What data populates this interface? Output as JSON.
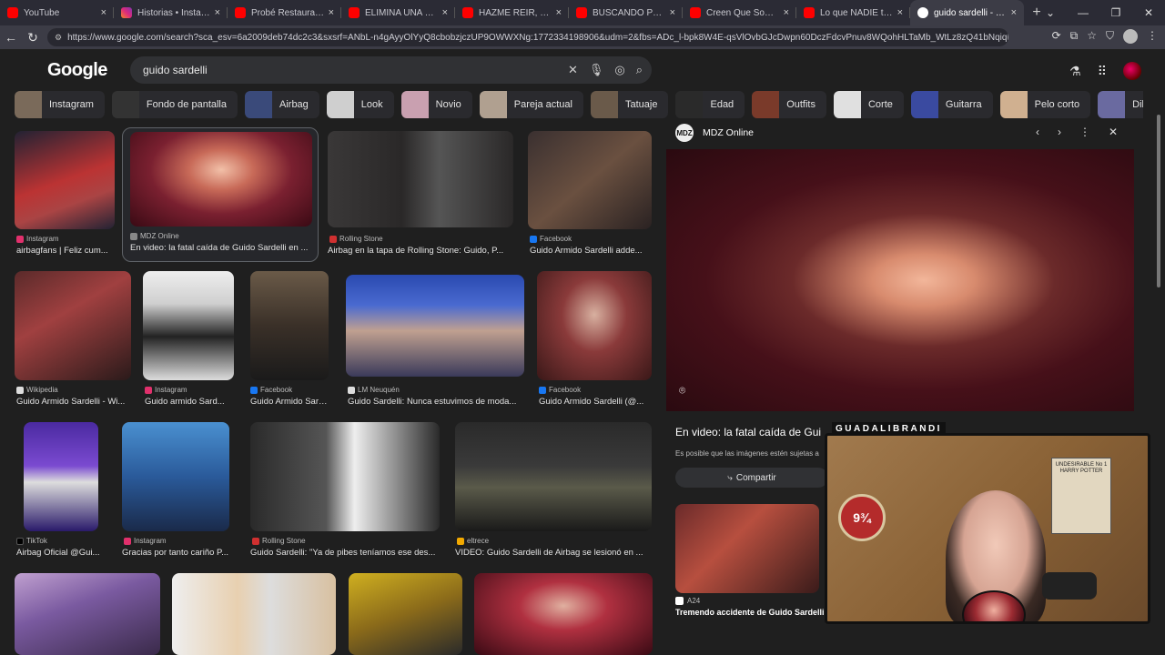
{
  "browser": {
    "tabs": [
      {
        "label": "YouTube",
        "color": "#ff0000"
      },
      {
        "label": "Historias • Instagram",
        "color": "#e1306c"
      },
      {
        "label": "Probé Restaurantes con",
        "color": "#ff0000"
      },
      {
        "label": "ELIMINA UNA CANCIÓN",
        "color": "#ff0000"
      },
      {
        "label": "HAZME REIR, GANA 100",
        "color": "#ff0000"
      },
      {
        "label": "BUSCANDO PROBLEMA",
        "color": "#ff0000"
      },
      {
        "label": "Creen Que Somos Tonto",
        "color": "#ff0000"
      },
      {
        "label": "Lo que NADIE te cuenta",
        "color": "#ff0000"
      },
      {
        "label": "guido sardelli - Buscar con",
        "color": "#4285f4"
      }
    ],
    "close_glyph": "×",
    "new_tab": "+",
    "url": "https://www.google.com/search?sca_esv=6a2009deb74dc2c3&sxsrf=ANbL-n4gAyyOlYyQ8cbobzjczUP9OWWXNg:1772334198906&udm=2&fbs=ADc_l-bpk8W4E-qsVlOvbGJcDwpn60DczFdcvPnuv8WQohHLTaMb_WtLz8zQ41bNqiqMK_2tAHCL8fGF2x..."
  },
  "google": {
    "logo": "Google",
    "query": "guido sardelli"
  },
  "chips": [
    {
      "label": "Instagram",
      "color": "#7a6a5a"
    },
    {
      "label": "Fondo de pantalla",
      "color": "#333333"
    },
    {
      "label": "Airbag",
      "color": "#3a4a7a"
    },
    {
      "label": "Look",
      "color": "#cfcfcf"
    },
    {
      "label": "Novio",
      "color": "#c9a0b0"
    },
    {
      "label": "Pareja actual",
      "color": "#b0a090"
    },
    {
      "label": "Tatuaje",
      "color": "#6a5a4a"
    },
    {
      "label": "Edad",
      "color": "#2a2a2a"
    },
    {
      "label": "Outfits",
      "color": "#7a3a2a"
    },
    {
      "label": "Corte",
      "color": "#e0e0e0"
    },
    {
      "label": "Guitarra",
      "color": "#3a4aa0"
    },
    {
      "label": "Pelo corto",
      "color": "#d0b090"
    },
    {
      "label": "Dibujo",
      "color": "#6a6aa0"
    }
  ],
  "results": [
    {
      "source": "Instagram",
      "caption": "airbagfans | Feliz cum...",
      "sc": "#e1306c"
    },
    {
      "source": "MDZ Online",
      "caption": "En video: la fatal caída de Guido Sardelli en ...",
      "sc": "#888888"
    },
    {
      "source": "Rolling Stone",
      "caption": "Airbag en la tapa de Rolling Stone: Guido, P...",
      "sc": "#d03030"
    },
    {
      "source": "Facebook",
      "caption": "Guido Armido Sardelli adde...",
      "sc": "#1877f2"
    },
    {
      "source": "Wikipedia",
      "caption": "Guido Armido Sardelli - Wi...",
      "sc": "#dddddd"
    },
    {
      "source": "Instagram",
      "caption": "Guido armido Sard...",
      "sc": "#e1306c"
    },
    {
      "source": "Facebook",
      "caption": "Guido Armido Sard...",
      "sc": "#1877f2"
    },
    {
      "source": "LM Neuquén",
      "caption": "Guido Sardelli: Nunca estuvimos de moda...",
      "sc": "#dddddd"
    },
    {
      "source": "Facebook",
      "caption": "Guido Armido Sardelli (@...",
      "sc": "#1877f2"
    },
    {
      "source": "TikTok",
      "caption": "Airbag Oficial @Gui...",
      "sc": "#000000"
    },
    {
      "source": "Instagram",
      "caption": "Gracias por tanto cariño P...",
      "sc": "#e1306c"
    },
    {
      "source": "Rolling Stone",
      "caption": "Guido Sardelli: \"Ya de pibes teníamos ese des...",
      "sc": "#d03030"
    },
    {
      "source": "eltrece",
      "caption": "VIDEO: Guido Sardelli de Airbag se lesionó en ...",
      "sc": "#f2a900"
    }
  ],
  "panel": {
    "source": "MDZ Online",
    "source_icon": "MDZ",
    "title": "En video: la fatal caída de Gui",
    "note": "Es posible que las imágenes estén sujetas a",
    "share": "Compartir",
    "related_source": "A24",
    "related_caption": "Tremendo accidente de Guido Sardelli ..."
  },
  "overlay": {
    "name": "GUADALIBRANDI",
    "platform": "9¾",
    "wanted": "UNDESIRABLE No 1 HARRY POTTER"
  }
}
